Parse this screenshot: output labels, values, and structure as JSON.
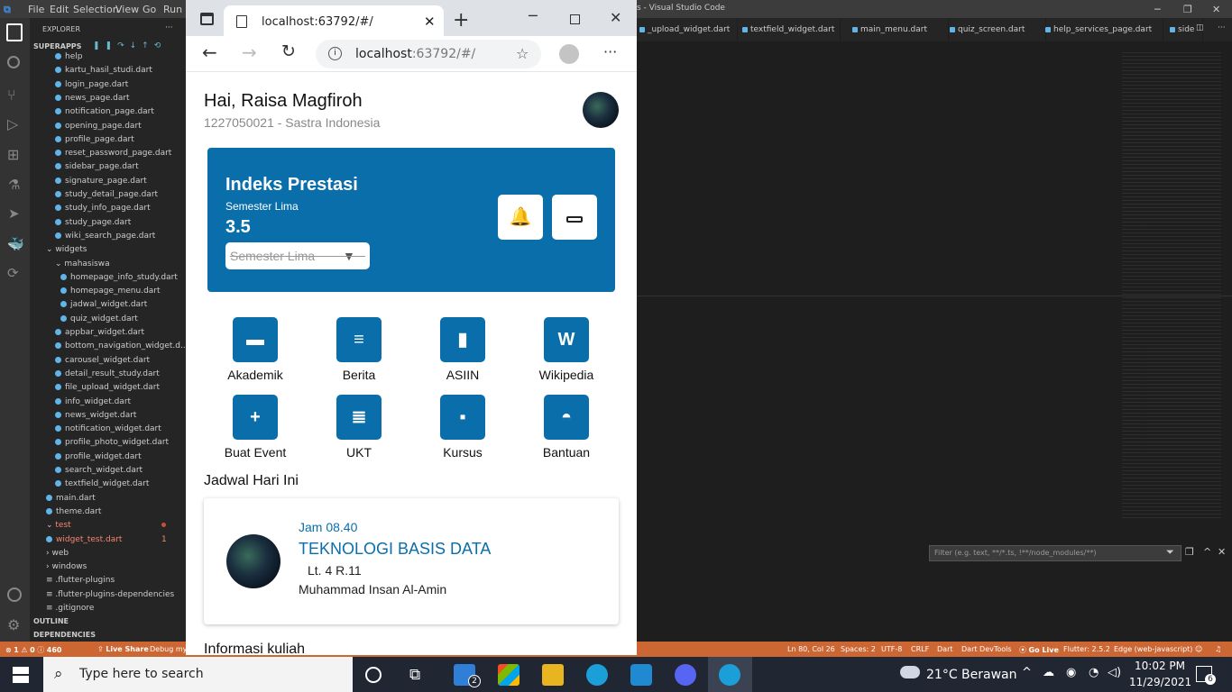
{
  "vscode": {
    "title_right": "s - Visual Studio Code",
    "menu": [
      "File",
      "Edit",
      "Selection",
      "View",
      "Go",
      "Run"
    ],
    "explorer_label": "EXPLORER",
    "project": "SUPERAPPS",
    "files": [
      {
        "name": "help",
        "level": 2
      },
      {
        "name": "kartu_hasil_studi.dart",
        "level": 2
      },
      {
        "name": "login_page.dart",
        "level": 2
      },
      {
        "name": "news_page.dart",
        "level": 2
      },
      {
        "name": "notification_page.dart",
        "level": 2
      },
      {
        "name": "opening_page.dart",
        "level": 2
      },
      {
        "name": "profile_page.dart",
        "level": 2
      },
      {
        "name": "reset_password_page.dart",
        "level": 2
      },
      {
        "name": "sidebar_page.dart",
        "level": 2
      },
      {
        "name": "signature_page.dart",
        "level": 2
      },
      {
        "name": "study_detail_page.dart",
        "level": 2
      },
      {
        "name": "study_info_page.dart",
        "level": 2
      },
      {
        "name": "study_page.dart",
        "level": 2
      },
      {
        "name": "wiki_search_page.dart",
        "level": 2
      },
      {
        "name": "widgets",
        "level": 1,
        "folder": true
      },
      {
        "name": "mahasiswa",
        "level": 2,
        "folder": true
      },
      {
        "name": "homepage_info_study.dart",
        "level": 3
      },
      {
        "name": "homepage_menu.dart",
        "level": 3
      },
      {
        "name": "jadwal_widget.dart",
        "level": 3
      },
      {
        "name": "quiz_widget.dart",
        "level": 3
      },
      {
        "name": "appbar_widget.dart",
        "level": 2
      },
      {
        "name": "bottom_navigation_widget.d...",
        "level": 2
      },
      {
        "name": "carousel_widget.dart",
        "level": 2
      },
      {
        "name": "detail_result_study.dart",
        "level": 2
      },
      {
        "name": "file_upload_widget.dart",
        "level": 2
      },
      {
        "name": "info_widget.dart",
        "level": 2
      },
      {
        "name": "news_widget.dart",
        "level": 2
      },
      {
        "name": "notification_widget.dart",
        "level": 2
      },
      {
        "name": "profile_photo_widget.dart",
        "level": 2
      },
      {
        "name": "profile_widget.dart",
        "level": 2
      },
      {
        "name": "search_widget.dart",
        "level": 2
      },
      {
        "name": "textfield_widget.dart",
        "level": 2
      },
      {
        "name": "main.dart",
        "level": 1
      },
      {
        "name": "theme.dart",
        "level": 1
      },
      {
        "name": "test",
        "level": 1,
        "folder": true,
        "error": true
      },
      {
        "name": "widget_test.dart",
        "level": 1,
        "error": true,
        "badge": "1"
      },
      {
        "name": "web",
        "level": 1,
        "folder": true,
        "collapsed": true
      },
      {
        "name": "windows",
        "level": 1,
        "folder": true,
        "collapsed": true
      },
      {
        "name": ".flutter-plugins",
        "level": 1,
        "plain": true
      },
      {
        "name": ".flutter-plugins-dependencies",
        "level": 1,
        "plain": true
      },
      {
        "name": ".gitignore",
        "level": 1,
        "plain": true
      }
    ],
    "outline_label": "OUTLINE",
    "dependencies_label": "DEPENDENCIES",
    "tabs": [
      "_upload_widget.dart",
      "textfield_widget.dart",
      "main_menu.dart",
      "quiz_screen.dart",
      "help_services_page.dart",
      "side"
    ],
    "filter_placeholder": "Filter (e.g. text, **/*.ts, !**/node_modules/**)",
    "status": {
      "errors": "1",
      "warnings": "0",
      "infos": "460",
      "live_share": "Live Share",
      "debug": "Debug my",
      "cursor": "Ln 80, Col 26",
      "spaces": "Spaces: 2",
      "encoding": "UTF-8",
      "eol": "CRLF",
      "language": "Dart",
      "devtools": "Dart DevTools",
      "golive": "Go Live",
      "flutter": "Flutter: 2.5.2",
      "device": "Edge (web-javascript)"
    }
  },
  "browser": {
    "tab_title": "localhost:63792/#/",
    "address_host": "localhost",
    "address_rest": ":63792/#/"
  },
  "app": {
    "greeting": "Hai, Raisa Magfiroh",
    "student_info": "1227050021 - Sastra Indonesia",
    "ip_card": {
      "title": "Indeks Prestasi",
      "semester": "Semester Lima",
      "ip_value": "3.5",
      "dropdown_value": "Semester Lima"
    },
    "menu": [
      {
        "label": "Akademik",
        "icon": "drive-icon"
      },
      {
        "label": "Berita",
        "icon": "article-icon"
      },
      {
        "label": "ASIIN",
        "icon": "file-icon"
      },
      {
        "label": "Wikipedia",
        "icon": "word-doc-icon"
      },
      {
        "label": "Buat Event",
        "icon": "add-document-icon"
      },
      {
        "label": "UKT",
        "icon": "receipt-icon"
      },
      {
        "label": "Kursus",
        "icon": "course-icon"
      },
      {
        "label": "Bantuan",
        "icon": "chat-bubble-icon"
      }
    ],
    "schedule_heading": "Jadwal Hari Ini",
    "schedule": {
      "time": "Jam 08.40",
      "course": "TEKNOLOGI BASIS DATA",
      "room": "Lt. 4 R.11",
      "lecturer": "Muhammad Insan Al-Amin"
    },
    "info_heading": "Informasi kuliah",
    "accent_color": "#0a6eab"
  },
  "taskbar": {
    "search_placeholder": "Type here to search",
    "mail_badge": "2",
    "weather": "21°C  Berawan",
    "time": "10:02 PM",
    "date": "11/29/2021",
    "notifications": "6"
  }
}
